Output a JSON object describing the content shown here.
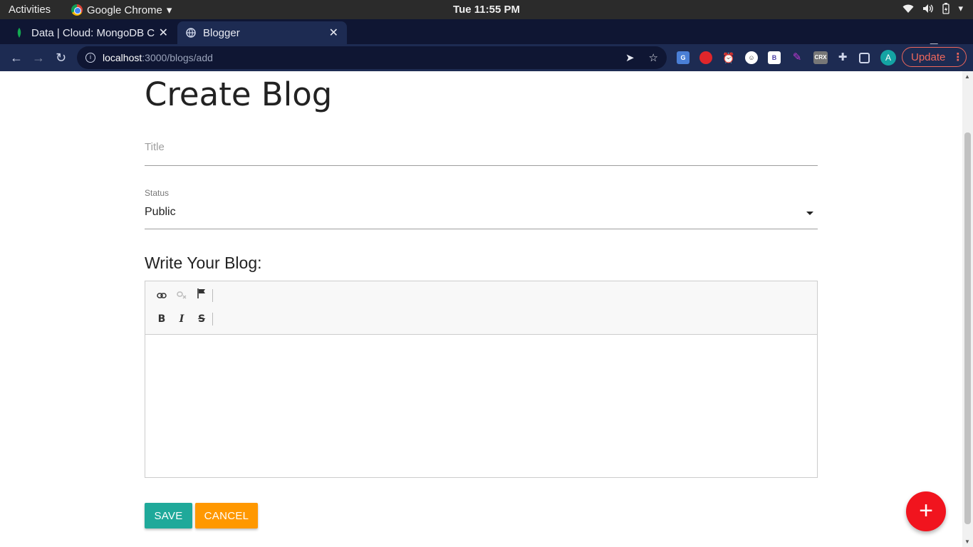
{
  "system_bar": {
    "activities": "Activities",
    "app_name": "Google Chrome",
    "clock": "Tue 11:55 PM"
  },
  "tabs": [
    {
      "title": "Data | Cloud: MongoDB Cl",
      "active": false
    },
    {
      "title": "Blogger",
      "active": true
    }
  ],
  "address_bar": {
    "host": "localhost",
    "path": ":3000/blogs/add"
  },
  "browser": {
    "profile_initial": "A",
    "update_label": "Update",
    "extensions": [
      "G",
      "",
      "",
      "",
      "B",
      "",
      "CRX",
      ""
    ]
  },
  "page": {
    "title": "Create Blog",
    "title_field": {
      "placeholder": "Title",
      "value": ""
    },
    "status": {
      "label": "Status",
      "selected": "Public"
    },
    "editor_label": "Write Your Blog:",
    "save_label": "SAVE",
    "cancel_label": "CANCEL",
    "fab_label": "+"
  },
  "colors": {
    "save": "#1fa99a",
    "cancel": "#ff9800",
    "fab": "#f1141e",
    "update": "#ee675c"
  }
}
